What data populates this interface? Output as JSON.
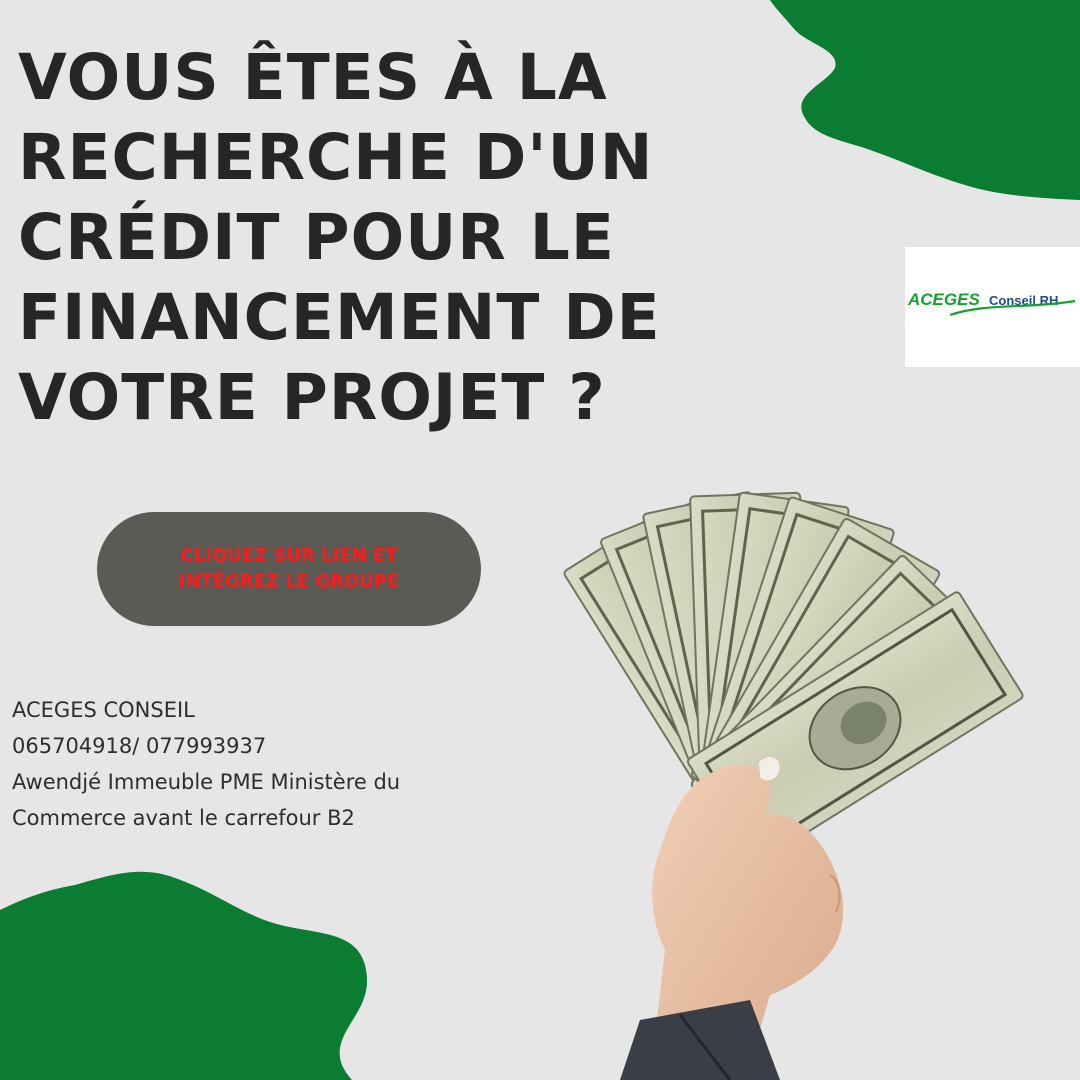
{
  "headline": {
    "lines": [
      "VOUS ÊTES À LA",
      "RECHERCHE D'UN",
      "CRÉDIT POUR LE",
      "FINANCEMENT DE",
      "VOTRE PROJET ?"
    ]
  },
  "logo": {
    "brand": "ACEGES",
    "suffix": "Conseil RH"
  },
  "cta": {
    "line1": "CLIQUEZ SUR LIEN ET",
    "line2": "INTÉGREZ LE GROUPE"
  },
  "contact": {
    "company": "ACEGES CONSEIL",
    "phones": "065704918/ 077993937",
    "address_line1": "Awendjé Immeuble PME Ministère du",
    "address_line2": "Commerce avant le carrefour B2"
  },
  "colors": {
    "background": "#e6e6e6",
    "blob_green": "#0b7d32",
    "headline": "#262626",
    "cta_bg": "#5b5a55",
    "cta_text": "#ff1b1b"
  },
  "icons": {
    "photo": "hand-holding-dollar-bills"
  }
}
